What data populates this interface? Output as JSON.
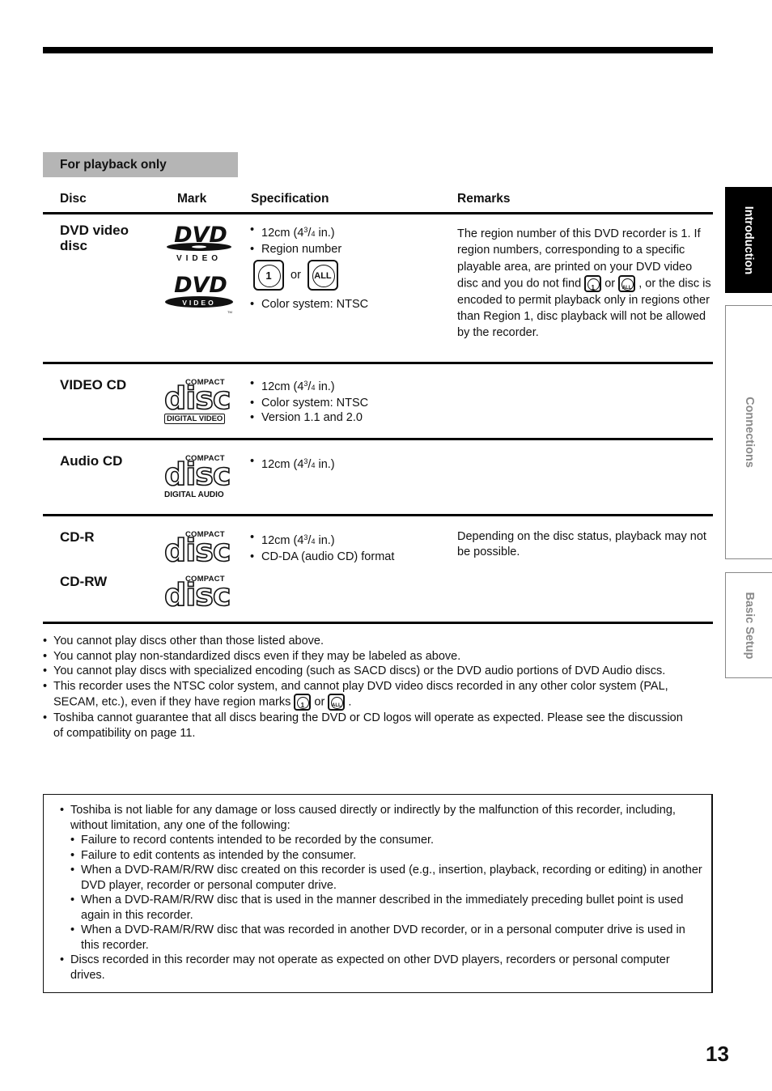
{
  "section_label": "For playback only",
  "table": {
    "headers": {
      "disc": "Disc",
      "mark": "Mark",
      "specification": "Specification",
      "remarks": "Remarks"
    },
    "rows": [
      {
        "disc": "DVD video disc",
        "marks": [
          "DVD VIDEO logo (outline)",
          "DVD VIDEO logo (solid)"
        ],
        "spec": {
          "size": "12cm (4",
          "size_frac_num": "3",
          "size_frac_den": "4",
          "size_tail": " in.)",
          "region_label": "Region number",
          "region_marks": [
            "1",
            "ALL"
          ],
          "region_or": "or",
          "color": "Color system: NTSC"
        },
        "remarks": {
          "part1": "The region number of this DVD recorder is 1. If region numbers, corresponding to a specific playable area, are printed on your DVD video disc and you do not find",
          "or": "or",
          "part2": ", or the disc is encoded to permit playback only in regions other than Region 1, disc playback will not be allowed by the recorder."
        }
      },
      {
        "disc": "VIDEO CD",
        "mark_sub": "DIGITAL VIDEO",
        "spec": [
          "Color system: NTSC",
          "Version 1.1 and 2.0"
        ]
      },
      {
        "disc": "Audio CD",
        "mark_sub": "DIGITAL AUDIO"
      },
      {
        "disc": "CD-R",
        "disc2": "CD-RW",
        "spec": [
          "CD-DA (audio CD) format"
        ],
        "remarks": "Depending on the disc status, playback may not be possible."
      }
    ],
    "logo_text": {
      "compact": "COMPACT",
      "disc": "disc",
      "dvd": "DVD",
      "video": "VIDEO",
      "tm": "TM"
    }
  },
  "notes": [
    "You cannot play discs other than those listed above.",
    "You cannot play non-standardized discs even if they may be labeled as above.",
    "You cannot play discs with specialized encoding (such as SACD discs) or the DVD audio portions of DVD Audio discs.",
    {
      "before": "This recorder uses the NTSC color system, and cannot play DVD video discs recorded in any other color system (PAL, SECAM, etc.), even if they have region marks",
      "or": "or",
      "after": "."
    },
    "Toshiba cannot guarantee that all discs bearing the DVD or CD logos will operate as expected.  Please see the discussion of compatibility on page 11."
  ],
  "caution": {
    "item1": "Toshiba is not liable for any damage or loss caused directly or indirectly by the malfunction of this recorder, including, without limitation, any one of the following:",
    "sub": [
      "Failure to record contents intended to be recorded by the consumer.",
      "Failure to edit contents as intended by the consumer.",
      "When a DVD-RAM/R/RW disc created on this recorder is used (e.g., insertion, playback, recording or editing) in another DVD player, recorder or personal computer drive.",
      "When a DVD-RAM/R/RW disc that is used in the manner described in the immediately preceding bullet point is used again in this recorder.",
      "When a DVD-RAM/R/RW disc that was recorded in another DVD recorder, or in a personal computer drive is used in this recorder."
    ],
    "item2": "Discs recorded in this recorder may not operate as expected on other DVD players, recorders or personal computer drives."
  },
  "side_tabs": [
    {
      "label": "Introduction",
      "active": true
    },
    {
      "label": "Connections",
      "active": false
    },
    {
      "label": "Basic Setup",
      "active": false
    }
  ],
  "page_number": "13"
}
